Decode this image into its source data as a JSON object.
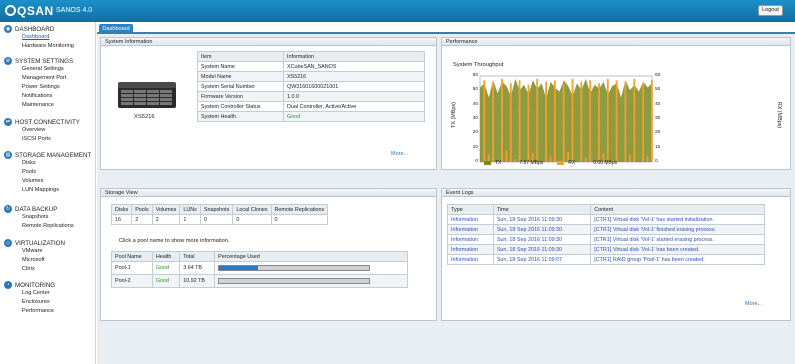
{
  "app": {
    "brand": "QSAN",
    "product": "SANOS 4.0",
    "logout_label": "Logout"
  },
  "tab": "Dashboard",
  "sidebar": [
    {
      "icon": "dashboard-icon",
      "glyph": "◉",
      "title": "DASHBOARD",
      "items": [
        "Dashboard",
        "Hardware Monitoring"
      ]
    },
    {
      "icon": "gear-icon",
      "glyph": "⚙",
      "title": "SYSTEM SETTINGS",
      "items": [
        "General Settings",
        "Management Port",
        "Power Settings",
        "Notifications",
        "Maintenance"
      ]
    },
    {
      "icon": "network-icon",
      "glyph": "⇄",
      "title": "HOST CONNECTIVITY",
      "items": [
        "Overview",
        "iSCSI Ports"
      ]
    },
    {
      "icon": "storage-icon",
      "glyph": "▤",
      "title": "STORAGE MANAGEMENT",
      "items": [
        "Disks",
        "Pools",
        "Volumes",
        "LUN Mappings"
      ]
    },
    {
      "icon": "backup-icon",
      "glyph": "↻",
      "title": "DATA BACKUP",
      "items": [
        "Snapshots",
        "Remote Replications"
      ]
    },
    {
      "icon": "virtualization-icon",
      "glyph": "◇",
      "title": "VIRTUALIZATION",
      "items": [
        "VMware",
        "Microsoft",
        "Citrix"
      ]
    },
    {
      "icon": "monitoring-icon",
      "glyph": "◔",
      "title": "MONITORING",
      "items": [
        "Log Center",
        "Enclosures",
        "Performance"
      ]
    }
  ],
  "sysinfo": {
    "title": "System Information",
    "model_caption": "XS5216",
    "headers": [
      "Item",
      "Information"
    ],
    "rows": [
      [
        "System Name",
        "XCubeSAN_SANOS"
      ],
      [
        "Model Name",
        "XS5216"
      ],
      [
        "System Serial Number",
        "QW31601600021001"
      ],
      [
        "Firmware Version",
        "1.0.0"
      ],
      [
        "System Controller Status",
        "Dual Controller, Active/Active"
      ],
      [
        "System Health",
        "Good"
      ]
    ],
    "more": "More..."
  },
  "performance": {
    "title": "Performance",
    "chart_title": "System Throughput",
    "ylabel_left": "TX (MBps)",
    "ylabel_right": "RX (MBps)",
    "legend_tx_label": "TX",
    "legend_tx_value": "7.57 MBps",
    "legend_rx_label": "RX",
    "legend_rx_value": "0.00 MBps",
    "y_ticks": [
      "60",
      "50",
      "40",
      "30",
      "20",
      "10",
      "0"
    ]
  },
  "chart_data": {
    "type": "area",
    "title": "System Throughput",
    "ylabel": "TX (MBps)",
    "y2label": "RX (MBps)",
    "ylim": [
      0,
      60
    ],
    "grid": true,
    "legend": "bottom",
    "series": [
      {
        "name": "TX",
        "color": "#7a8a1c",
        "values": [
          52,
          55,
          45,
          57,
          48,
          56,
          53,
          46,
          58,
          50,
          54,
          47,
          57,
          51,
          55,
          44,
          56,
          52,
          49,
          57,
          53,
          46,
          55,
          50,
          58,
          48,
          54,
          51,
          56,
          47,
          53,
          55,
          45,
          57,
          50,
          54,
          49,
          56,
          52,
          55
        ]
      },
      {
        "name": "RX",
        "color": "#f0a030",
        "values": [
          0,
          57,
          5,
          56,
          0,
          58,
          8,
          55,
          2,
          57,
          0,
          54,
          6,
          58,
          0,
          56,
          4,
          57,
          0,
          55,
          7,
          58,
          0,
          56,
          3,
          57,
          0,
          55,
          6,
          58,
          1,
          57,
          0,
          56,
          5,
          58,
          0,
          55,
          4,
          57
        ]
      }
    ]
  },
  "storage": {
    "title": "Storage View",
    "summary_headers": [
      "Disks",
      "Pools",
      "Volumes",
      "LUNs",
      "Snapshots",
      "Local Clones",
      "Remote Replications"
    ],
    "summary_values": [
      "16",
      "2",
      "2",
      "1",
      "0",
      "0",
      "0"
    ],
    "hint": "Click a pool name to show more information.",
    "pool_headers": [
      "Pool Name",
      "Health",
      "Total",
      "Percentage Used"
    ],
    "pools": [
      {
        "name": "Pool-1",
        "health": "Good",
        "total": "3.64 TB",
        "used_fraction": 0.26
      },
      {
        "name": "Pool-2",
        "health": "Good",
        "total": "10.92 TB",
        "used_fraction": 0.0
      }
    ]
  },
  "events": {
    "title": "Event Logs",
    "headers": [
      "Type",
      "Time",
      "Content"
    ],
    "rows": [
      [
        "Information",
        "Sun, 18 Sep 2016 11:09:30",
        "[CTR1] Virtual disk 'Vol-1' has started initialization."
      ],
      [
        "Information",
        "Sun, 18 Sep 2016 11:09:30",
        "[CTR1] Virtual disk 'Vol-1' finished erasing process."
      ],
      [
        "Information",
        "Sun, 18 Sep 2016 11:09:30",
        "[CTR1] Virtual disk 'Vol-1' started erasing process."
      ],
      [
        "Information",
        "Sun, 18 Sep 2016 11:09:30",
        "[CTR1] Virtual disk 'Vol-1' has been created."
      ],
      [
        "Information",
        "Sun, 18 Sep 2016 11:09:07",
        "[CTR1] RAID group 'Pool-1' has been created."
      ]
    ],
    "more": "More..."
  }
}
